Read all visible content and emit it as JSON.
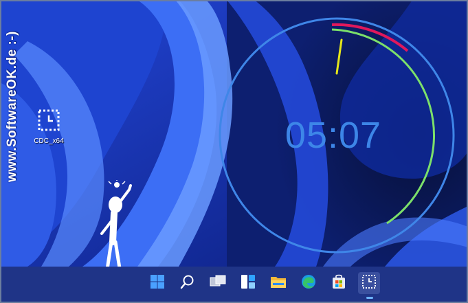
{
  "watermark": {
    "text": "www.SoftwareOK.de :-)"
  },
  "desktop": {
    "icons": [
      {
        "label": "CDC_x64",
        "icon": "clock-app-icon"
      }
    ]
  },
  "clock": {
    "time": "05:07",
    "ring_color": "#3f86e8",
    "second_color": "#e6e61a",
    "minute_color": "#e0185c",
    "hour_color": "#7ce06a"
  },
  "taskbar": {
    "items": [
      {
        "name": "start",
        "icon": "windows-start-icon"
      },
      {
        "name": "search",
        "icon": "search-icon"
      },
      {
        "name": "task-view",
        "icon": "task-view-icon"
      },
      {
        "name": "widgets",
        "icon": "widgets-icon"
      },
      {
        "name": "file-explorer",
        "icon": "folder-icon"
      },
      {
        "name": "edge",
        "icon": "edge-browser-icon"
      },
      {
        "name": "store",
        "icon": "store-icon"
      },
      {
        "name": "cdc",
        "icon": "clock-app-icon",
        "active": true
      }
    ]
  },
  "colors": {
    "wallpaper": "#0a1650",
    "taskbar": "#1f3487",
    "accent": "#3f86e8"
  }
}
